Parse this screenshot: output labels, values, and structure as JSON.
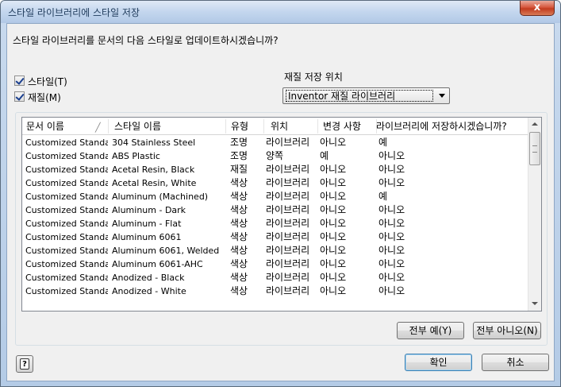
{
  "window": {
    "title": "스타일 라이브러리에 스타일 저장",
    "close_glyph": "x"
  },
  "question": "스타일 라이브러리를 문서의 다음 스타일로 업데이트하시겠습니까?",
  "options": {
    "styles_label": "스타일(T)",
    "materials_label": "재질(M)"
  },
  "material_location": {
    "label": "재질 저장 위치",
    "selected": "Inventor 재질 라이브러리"
  },
  "table": {
    "columns": [
      "문서 이름",
      "스타일 이름",
      "유형",
      "위치",
      "변경 사항",
      "라이브러리에 저장하시겠습니까?"
    ],
    "rows": [
      [
        "Customized Standard",
        "304 Stainless Steel",
        "조명",
        "라이브러리",
        "아니오",
        "예"
      ],
      [
        "Customized Standard",
        "ABS Plastic",
        "조명",
        "양쪽",
        "예",
        "아니오"
      ],
      [
        "Customized Standard",
        "Acetal Resin, Black",
        "재질",
        "라이브러리",
        "아니오",
        "아니오"
      ],
      [
        "Customized Standard",
        "Acetal Resin, White",
        "색상",
        "라이브러리",
        "아니오",
        "아니오"
      ],
      [
        "Customized Standard",
        "Aluminum (Machined)",
        "색상",
        "라이브러리",
        "아니오",
        "예"
      ],
      [
        "Customized Standard",
        "Aluminum - Dark",
        "색상",
        "라이브러리",
        "아니오",
        "아니오"
      ],
      [
        "Customized Standard",
        "Aluminum - Flat",
        "색상",
        "라이브러리",
        "아니오",
        "아니오"
      ],
      [
        "Customized Standard",
        "Aluminum 6061",
        "색상",
        "라이브러리",
        "아니오",
        "아니오"
      ],
      [
        "Customized Standard",
        "Aluminum 6061, Welded",
        "색상",
        "라이브러리",
        "아니오",
        "아니오"
      ],
      [
        "Customized Standard",
        "Aluminum 6061-AHC",
        "색상",
        "라이브러리",
        "아니오",
        "아니오"
      ],
      [
        "Customized Standard",
        "Anodized - Black",
        "색상",
        "라이브러리",
        "아니오",
        "아니오"
      ],
      [
        "Customized Standard",
        "Anodized - White",
        "색상",
        "라이브러리",
        "아니오",
        "아니오"
      ]
    ]
  },
  "buttons": {
    "all_yes": "전부 예(Y)",
    "all_no": "전부 아니오(N)",
    "ok": "확인",
    "cancel": "취소"
  }
}
